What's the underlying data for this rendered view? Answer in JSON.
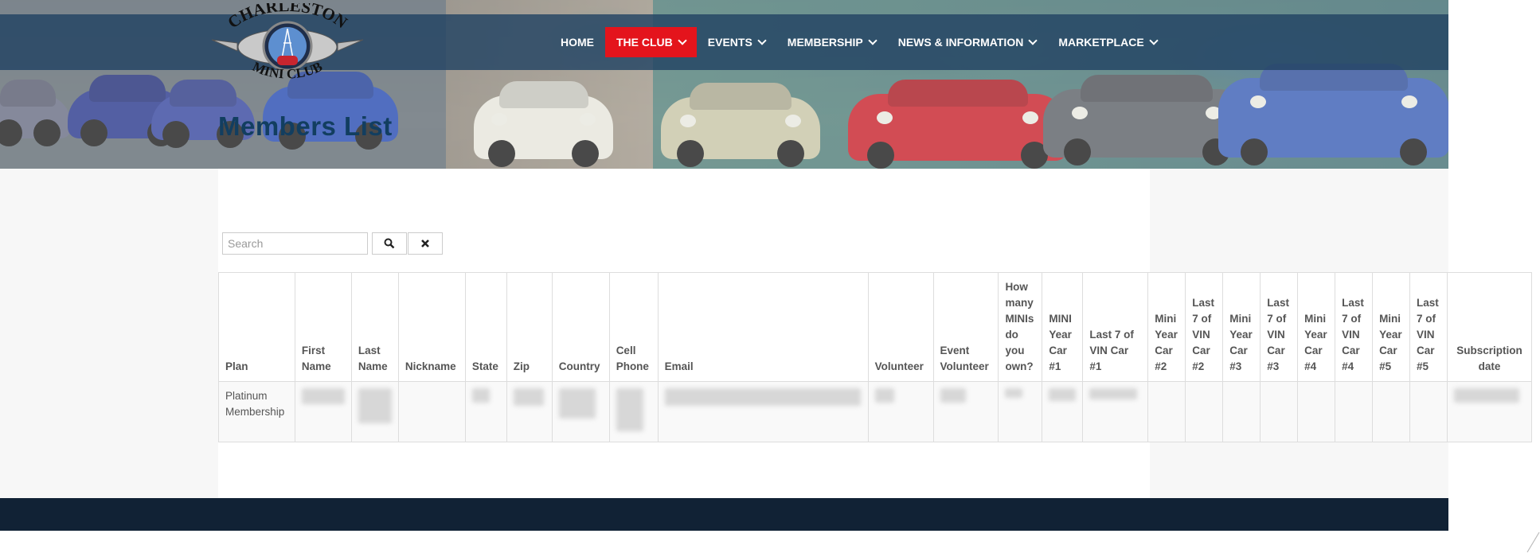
{
  "site": {
    "logo_text_top": "CHARLESTON",
    "logo_text_bottom": "MINI CLUB"
  },
  "nav": {
    "items": [
      {
        "label": "HOME",
        "dropdown": false,
        "active": false
      },
      {
        "label": "THE CLUB",
        "dropdown": true,
        "active": true
      },
      {
        "label": "EVENTS",
        "dropdown": true,
        "active": false
      },
      {
        "label": "MEMBERSHIP",
        "dropdown": true,
        "active": false
      },
      {
        "label": "NEWS & INFORMATION",
        "dropdown": true,
        "active": false
      },
      {
        "label": "MARKETPLACE",
        "dropdown": true,
        "active": false
      }
    ]
  },
  "page": {
    "title": "Members List"
  },
  "search": {
    "placeholder": "Search",
    "value": "",
    "search_icon": "search-icon",
    "clear_icon": "clear-icon"
  },
  "table": {
    "columns": [
      "Plan",
      "First Name",
      "Last Name",
      "Nickname",
      "State",
      "Zip",
      "Country",
      "Cell Phone",
      "Email",
      "Volunteer",
      "Event Volunteer",
      "How many MINIs do you own?",
      "MINI Year Car #1",
      "Last 7 of VIN Car #1",
      "Mini Year Car #2",
      "Last 7 of VIN Car #2",
      "Mini Year Car #3",
      "Last 7 of VIN Car #3",
      "Mini Year Car #4",
      "Last 7 of VIN Car #4",
      "Mini Year Car #5",
      "Last 7 of VIN Car #5",
      "Subscription date"
    ],
    "rows": [
      {
        "plan": "Platinum Membership"
      }
    ]
  },
  "colors": {
    "nav_bg": "#224363",
    "active": "#e4141c",
    "title": "#123e60",
    "footer": "#112235"
  }
}
